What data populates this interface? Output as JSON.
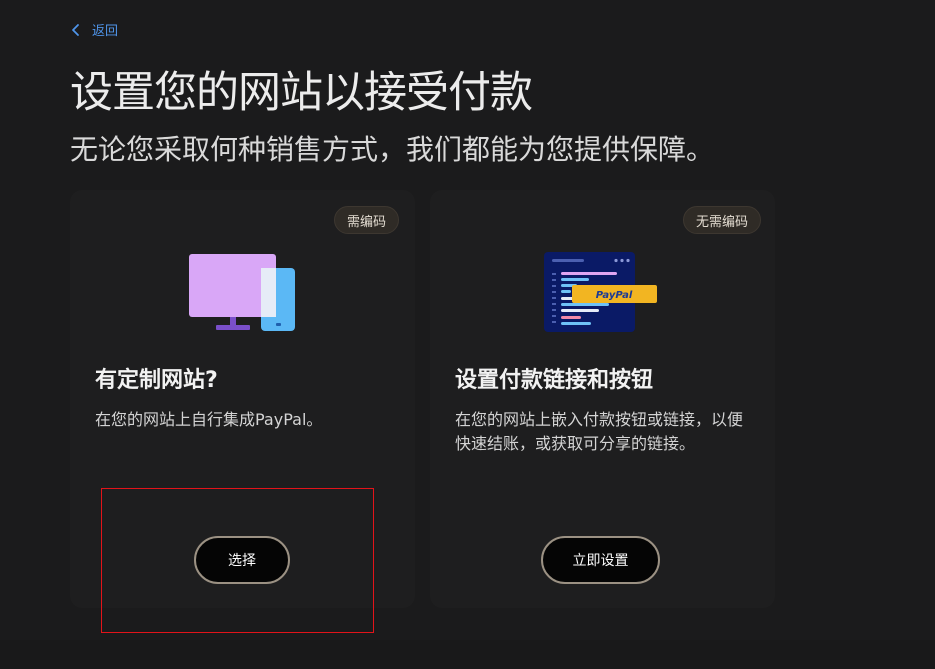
{
  "back": {
    "label": "返回"
  },
  "header": {
    "title": "设置您的网站以接受付款",
    "subtitle": "无论您采取何种销售方式，我们都能为您提供保障。"
  },
  "cards": [
    {
      "badge": "需编码",
      "title": "有定制网站?",
      "description": "在您的网站上自行集成PayPal。",
      "button_label": "选择"
    },
    {
      "badge": "无需编码",
      "title": "设置付款链接和按钮",
      "description": "在您的网站上嵌入付款按钮或链接，以便快速结账，或获取可分享的链接。",
      "button_label": "立即设置",
      "illustration_badge": "PayPal"
    }
  ],
  "colors": {
    "background": "#1b1b1c",
    "link": "#4f95ea",
    "button_border": "#9b9183",
    "highlight": "#e3141a",
    "monitor": "#d9a7f7",
    "phone": "#5bb8f5",
    "paypal_badge": "#f2b522"
  },
  "icons": {
    "back": "chevron-left-icon",
    "left_illustration": "desktop-and-phone-icon",
    "right_illustration": "code-window-paypal-icon"
  }
}
